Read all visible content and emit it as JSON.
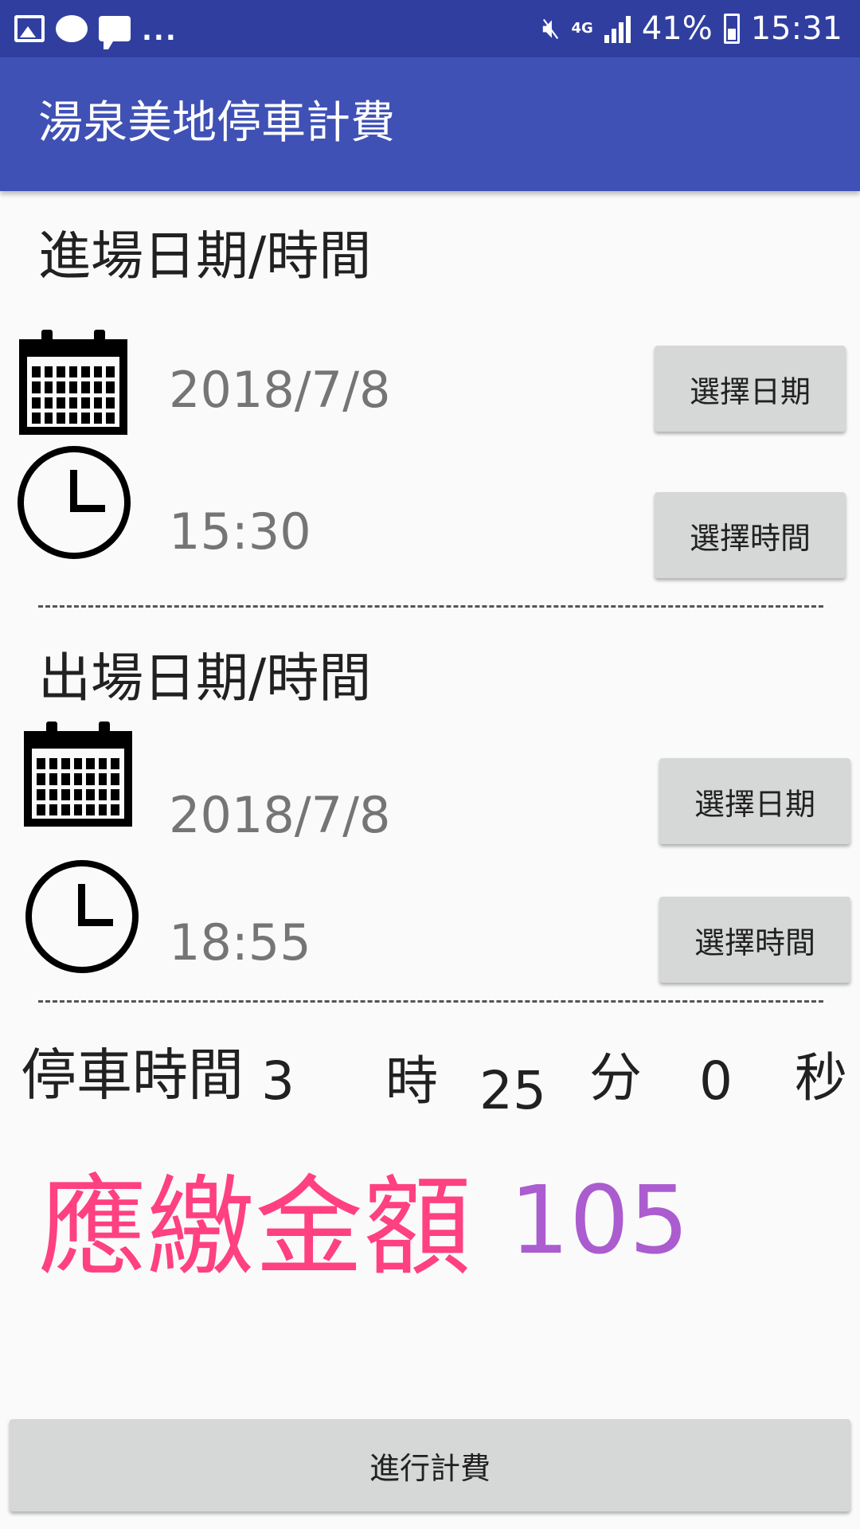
{
  "status_bar": {
    "notification_icons": [
      "image-icon",
      "hangouts-icon",
      "message-icon"
    ],
    "overflow": "...",
    "network": "4G",
    "battery": "41%",
    "time": "15:31"
  },
  "toolbar": {
    "title": "湯泉美地停車計費"
  },
  "entry": {
    "title": "進場日期/時間",
    "date": "2018/7/8",
    "time": "15:30",
    "date_button": "選擇日期",
    "time_button": "選擇時間"
  },
  "exit": {
    "title": "出場日期/時間",
    "date": "2018/7/8",
    "time": "18:55",
    "date_button": "選擇日期",
    "time_button": "選擇時間"
  },
  "duration": {
    "label": "停車時間",
    "hours": "3",
    "hours_unit": "時",
    "minutes": "25",
    "minutes_unit": "分",
    "seconds": "0",
    "seconds_unit": "秒"
  },
  "fee": {
    "label": "應繳金額",
    "amount": "105"
  },
  "calculate_button": "進行計費",
  "colors": {
    "status_bar": "#303f9f",
    "toolbar": "#3f51b5",
    "fee_label": "#ff4081",
    "fee_amount": "#ab5ccf",
    "button": "#d6d7d7"
  }
}
